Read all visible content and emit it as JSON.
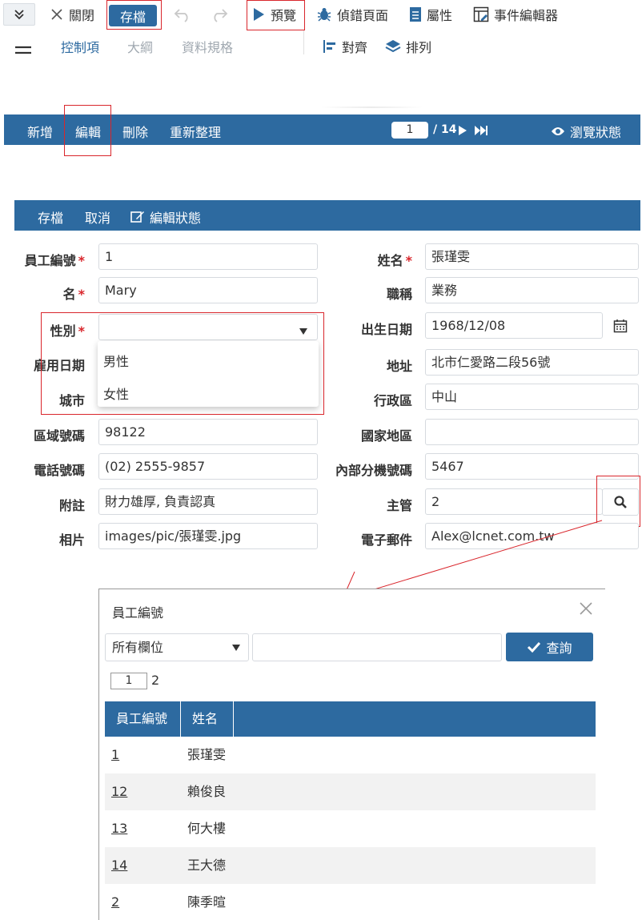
{
  "toolbar": {
    "close_label": "關閉",
    "save_label": "存檔",
    "preview_label": "預覽",
    "debug_label": "偵錯頁面",
    "properties_label": "屬性",
    "event_editor_label": "事件編輯器"
  },
  "tabs": {
    "controls": "控制項",
    "outline": "大綱",
    "data_spec": "資料規格"
  },
  "side_tools": {
    "align": "對齊",
    "arrange": "排列"
  },
  "navbar": {
    "add": "新增",
    "edit": "編輯",
    "delete": "刪除",
    "refresh": "重新整理",
    "page_current": "1",
    "page_total": "/ 14",
    "browse_state": "瀏覽狀態"
  },
  "formbar": {
    "save": "存檔",
    "cancel": "取消",
    "edit_state": "編輯狀態"
  },
  "form": {
    "emp_id": {
      "label": "員工編號",
      "value": "1"
    },
    "name": {
      "label": "姓名",
      "value": "張瑾雯"
    },
    "first_name": {
      "label": "名",
      "value": "Mary"
    },
    "title": {
      "label": "職稱",
      "value": "業務"
    },
    "gender": {
      "label": "性別",
      "value": ""
    },
    "birthdate": {
      "label": "出生日期",
      "value": "1968/12/08"
    },
    "hire_date": {
      "label": "雇用日期"
    },
    "address": {
      "label": "地址",
      "value": "北市仁愛路二段56號"
    },
    "city": {
      "label": "城市"
    },
    "district": {
      "label": "行政區",
      "value": "中山"
    },
    "zip": {
      "label": "區域號碼",
      "value": "98122"
    },
    "country": {
      "label": "國家地區",
      "value": ""
    },
    "phone": {
      "label": "電話號碼",
      "value": "(02) 2555-9857"
    },
    "ext": {
      "label": "內部分機號碼",
      "value": "5467"
    },
    "notes": {
      "label": "附註",
      "value": "財力雄厚, 負責認真"
    },
    "manager": {
      "label": "主管",
      "value": "2"
    },
    "photo": {
      "label": "相片",
      "value": "images/pic/張瑾雯.jpg"
    },
    "email": {
      "label": "電子郵件",
      "value": "Alex@lcnet.com.tw"
    }
  },
  "gender_options": [
    "男性",
    "女性"
  ],
  "dialog": {
    "title": "員工編號",
    "field_select": "所有欄位",
    "query_label": "查詢",
    "page_current": "1",
    "page_total": "2",
    "columns": [
      "員工編號",
      "姓名"
    ],
    "rows": [
      {
        "id": "1",
        "name": "張瑾雯"
      },
      {
        "id": "12",
        "name": "賴俊良"
      },
      {
        "id": "13",
        "name": "何大樓"
      },
      {
        "id": "14",
        "name": "王大德"
      },
      {
        "id": "2",
        "name": "陳季暄"
      }
    ]
  },
  "colors": {
    "primary": "#2d6aa0",
    "required": "#d9262c",
    "highlight": "#d9262c"
  }
}
